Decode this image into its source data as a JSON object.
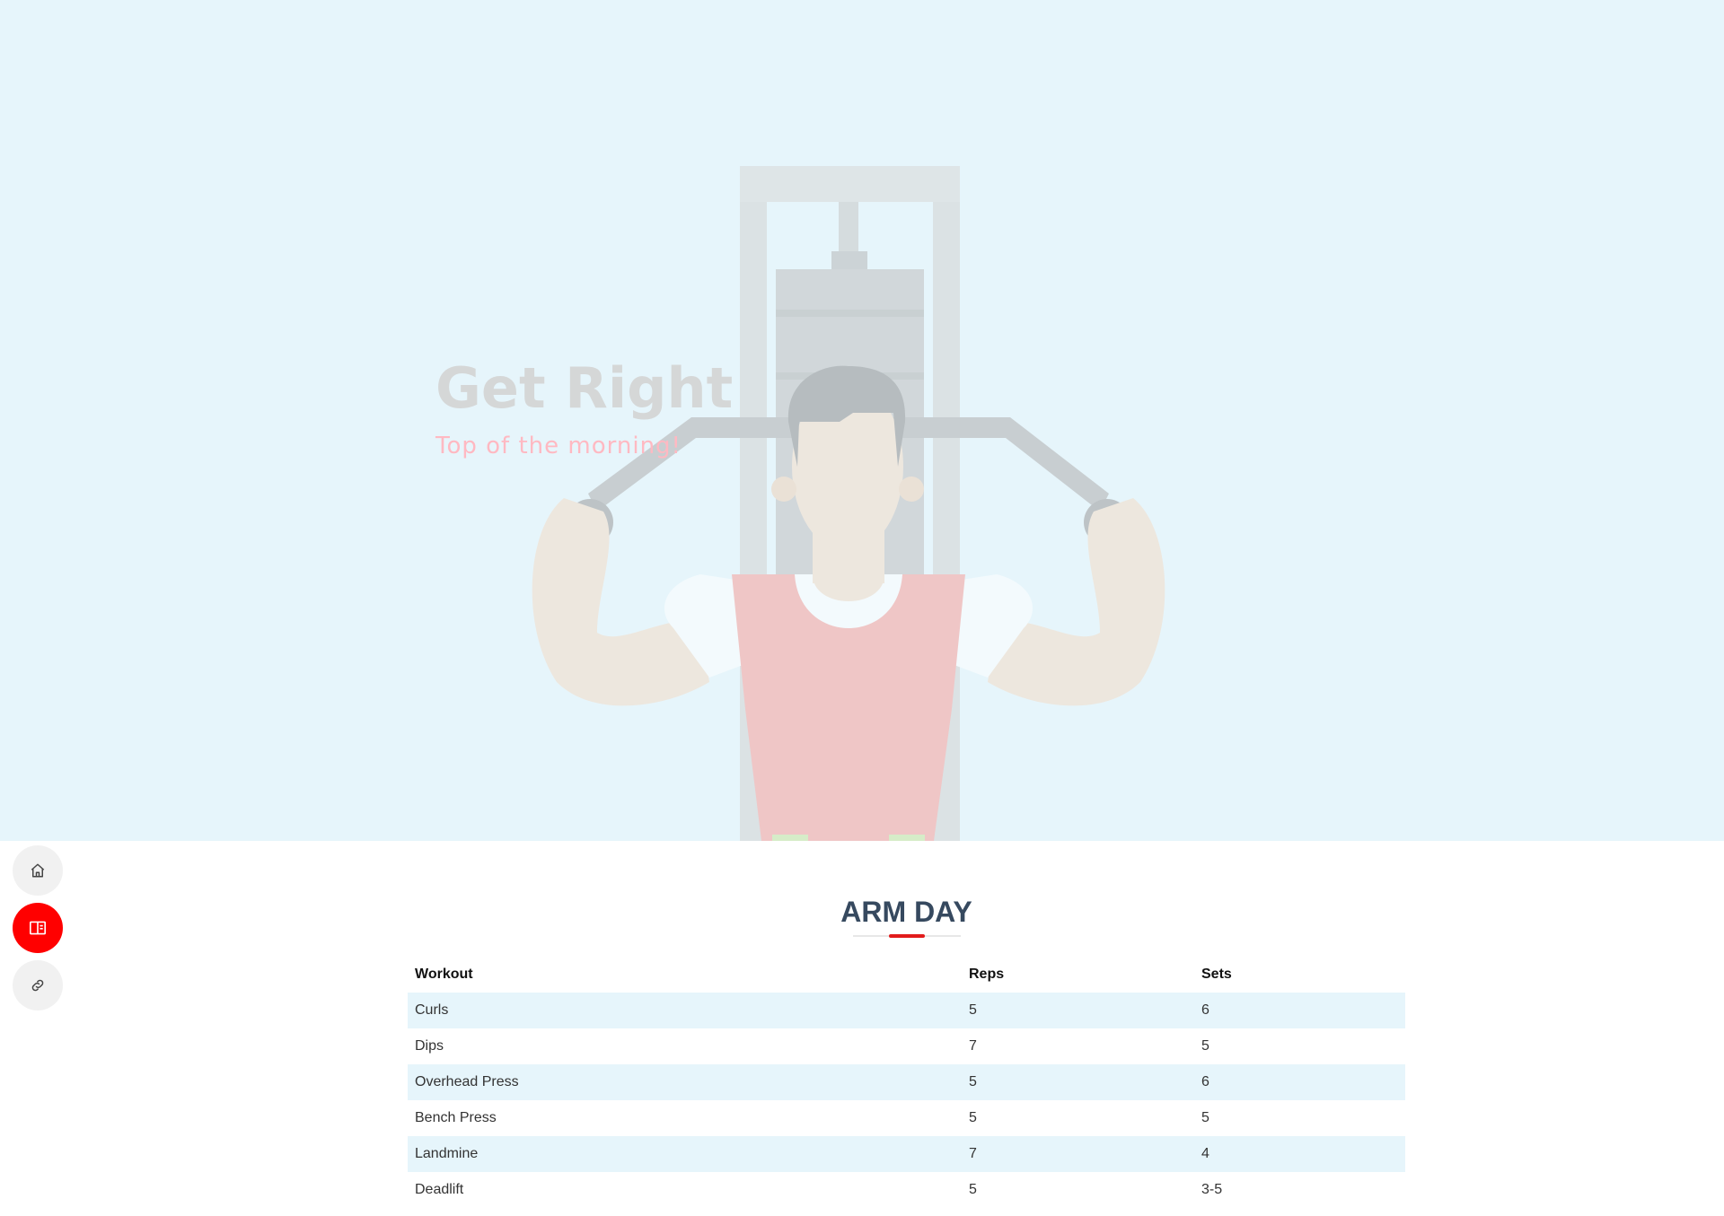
{
  "hero": {
    "title": "Get Right",
    "subtitle": "Top of the morning!"
  },
  "nav": {
    "items": [
      {
        "icon": "home-icon",
        "active": false
      },
      {
        "icon": "book-icon",
        "active": true
      },
      {
        "icon": "link-icon",
        "active": false
      }
    ]
  },
  "section": {
    "title": "ARM DAY"
  },
  "table": {
    "headers": [
      "Workout",
      "Reps",
      "Sets"
    ],
    "rows": [
      [
        "Curls",
        "5",
        "6"
      ],
      [
        "Dips",
        "7",
        "5"
      ],
      [
        "Overhead Press",
        "5",
        "6"
      ],
      [
        "Bench Press",
        "5",
        "5"
      ],
      [
        "Landmine",
        "7",
        "4"
      ],
      [
        "Deadlift",
        "5",
        "3-5"
      ]
    ]
  },
  "colors": {
    "accent": "#ff0000",
    "hero_bg": "#e6f5fb",
    "title": "#36495f"
  }
}
